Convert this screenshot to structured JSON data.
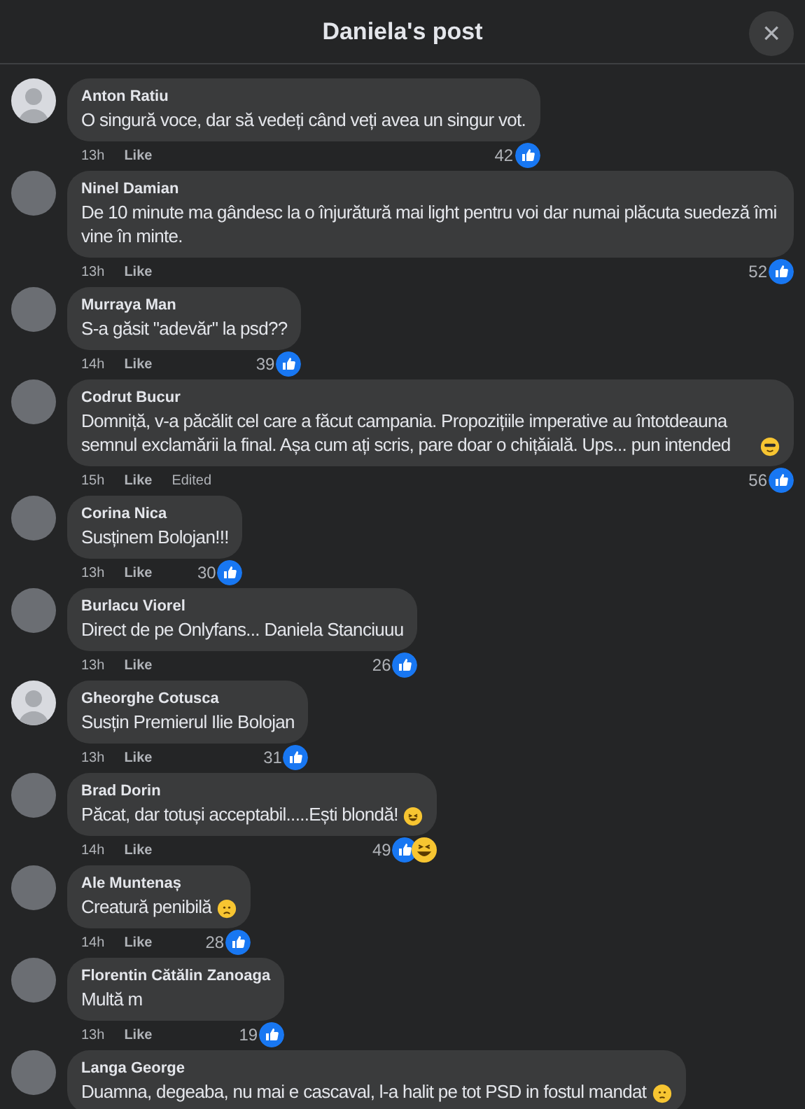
{
  "header": {
    "title": "Daniela's post",
    "close": "×"
  },
  "comments": [
    {
      "avatar": {
        "kind": "default"
      },
      "name": "Anton Ratiu",
      "text": "O singură voce, dar să vedeți când veți avea un singur vot.",
      "time": "13h",
      "like": "Like",
      "count": "42",
      "reactions": [
        {
          "kind": "like"
        }
      ]
    },
    {
      "avatar": {
        "kind": "photo"
      },
      "name": "Ninel Damian",
      "text": "De 10 minute ma gândesc la o înjurătură mai light pentru voi dar numai plăcuta suedeză îmi vine în minte.",
      "time": "13h",
      "like": "Like",
      "count": "52",
      "reactions": [
        {
          "kind": "like"
        }
      ]
    },
    {
      "avatar": {
        "kind": "photo"
      },
      "name": "Murraya Man",
      "text": "S-a găsit \"adevăr\" la psd??",
      "time": "14h",
      "like": "Like",
      "count": "39",
      "reactions": [
        {
          "kind": "like"
        }
      ]
    },
    {
      "avatar": {
        "kind": "photo"
      },
      "name": "Codrut Bucur",
      "text": "Domniță, v-a păcălit cel care a făcut campania. Propozițiile imperative au întotdeauna semnul exclamării la final. Așa cum ați scris, pare doar o chițăială. Ups... pun intended",
      "emoji": {
        "kind": "cool"
      },
      "time": "15h",
      "like": "Like",
      "edited": "Edited",
      "count": "56",
      "reactions": [
        {
          "kind": "like"
        }
      ]
    },
    {
      "avatar": {
        "kind": "photo"
      },
      "name": "Corina Nica",
      "text": "Susținem Bolojan!!!",
      "time": "13h",
      "like": "Like",
      "count": "30",
      "reactions": [
        {
          "kind": "like"
        }
      ]
    },
    {
      "avatar": {
        "kind": "photo"
      },
      "name": "Burlacu Viorel",
      "text": "Direct de pe Onlyfans... Daniela Stanciuuu",
      "time": "13h",
      "like": "Like",
      "count": "26",
      "reactions": [
        {
          "kind": "like"
        }
      ]
    },
    {
      "avatar": {
        "kind": "default"
      },
      "name": "Gheorghe Cotusca",
      "text": "Susțin Premierul Ilie Bolojan",
      "time": "13h",
      "like": "Like",
      "count": "31",
      "reactions": [
        {
          "kind": "like"
        }
      ]
    },
    {
      "avatar": {
        "kind": "photo"
      },
      "name": "Brad Dorin",
      "text": "Păcat, dar totuși acceptabil.....Ești blondă!",
      "emoji": {
        "kind": "laugh"
      },
      "time": "14h",
      "like": "Like",
      "count": "49",
      "reactions": [
        {
          "kind": "like"
        },
        {
          "kind": "haha"
        }
      ]
    },
    {
      "avatar": {
        "kind": "photo"
      },
      "name": "Ale Muntenaș",
      "text": "Creatură penibilă",
      "emoji": {
        "kind": "sad"
      },
      "time": "14h",
      "like": "Like",
      "count": "28",
      "reactions": [
        {
          "kind": "like"
        }
      ]
    },
    {
      "avatar": {
        "kind": "photo"
      },
      "name": "Florentin Cătălin Zanoaga",
      "text": "Multă m",
      "time": "13h",
      "like": "Like",
      "count": "19",
      "reactions": [
        {
          "kind": "like"
        }
      ]
    },
    {
      "avatar": {
        "kind": "photo"
      },
      "name": "Langa George",
      "text": "Duamna, degeaba, nu mai e cascaval, l-a halit pe tot PSD in fostul mandat",
      "emoji": {
        "kind": "worried"
      }
    }
  ]
}
